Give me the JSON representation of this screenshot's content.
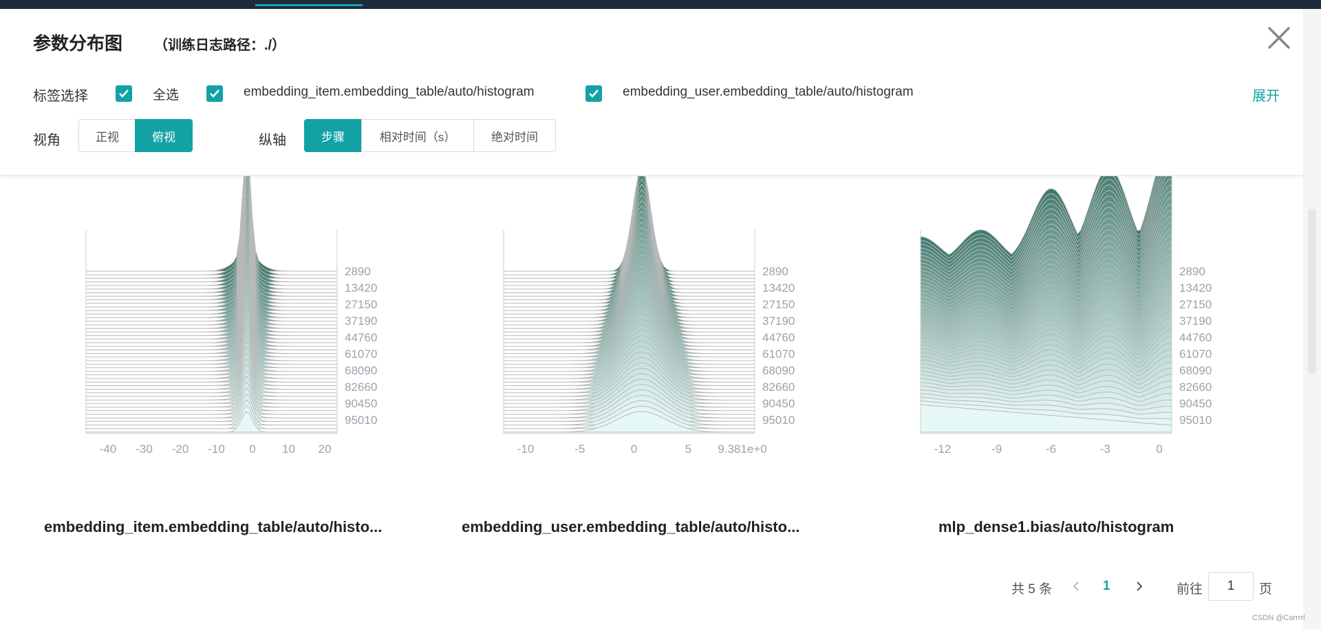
{
  "header": {
    "title": "参数分布图",
    "subtitle": "（训练日志路径：./）",
    "close_icon": "close-icon"
  },
  "tags": {
    "label": "标签选择",
    "select_all": "全选",
    "items": [
      "embedding_item.embedding_table/auto/histogram",
      "embedding_user.embedding_table/auto/histogram"
    ],
    "expand": "展开",
    "checkbox_color": "#12a2a6"
  },
  "view": {
    "label": "视角",
    "options": [
      "正视",
      "俯视"
    ],
    "selected": "俯视"
  },
  "yaxis": {
    "label": "纵轴",
    "options": [
      "步骤",
      "相对时间（s）",
      "绝对时间"
    ],
    "selected": "步骤"
  },
  "charts": [
    {
      "title": "embedding_item.embedding_table/auto/histo...",
      "x_ticks": [
        "-40",
        "-30",
        "-20",
        "-10",
        "0",
        "10",
        "20"
      ],
      "y_ticks": [
        "2890",
        "13420",
        "27150",
        "37190",
        "44760",
        "61070",
        "68090",
        "82660",
        "90450",
        "95010"
      ]
    },
    {
      "title": "embedding_user.embedding_table/auto/histo...",
      "x_ticks": [
        "-10",
        "-5",
        "0",
        "5",
        "9.381e+0"
      ],
      "y_ticks": [
        "2890",
        "13420",
        "27150",
        "37190",
        "44760",
        "61070",
        "68090",
        "82660",
        "90450",
        "95010"
      ]
    },
    {
      "title": "mlp_dense1.bias/auto/histogram",
      "x_ticks": [
        "-12",
        "-9",
        "-6",
        "-3",
        "0"
      ],
      "y_ticks": [
        "2890",
        "13420",
        "27150",
        "37190",
        "44760",
        "61070",
        "68090",
        "82660",
        "90450",
        "95010"
      ]
    }
  ],
  "pagination": {
    "total": "共 5 条",
    "current": "1",
    "goto_label": "前往",
    "goto_value": "1",
    "page_suffix": "页"
  },
  "watermark": "CSDN @Carrrrl",
  "colors": {
    "accent": "#12a2a6",
    "topbar": "#1f2a3a",
    "ridge_dark": "#3f7a6e",
    "ridge_light": "#e6f8f6",
    "ridge_line": "#b9b9b9"
  }
}
